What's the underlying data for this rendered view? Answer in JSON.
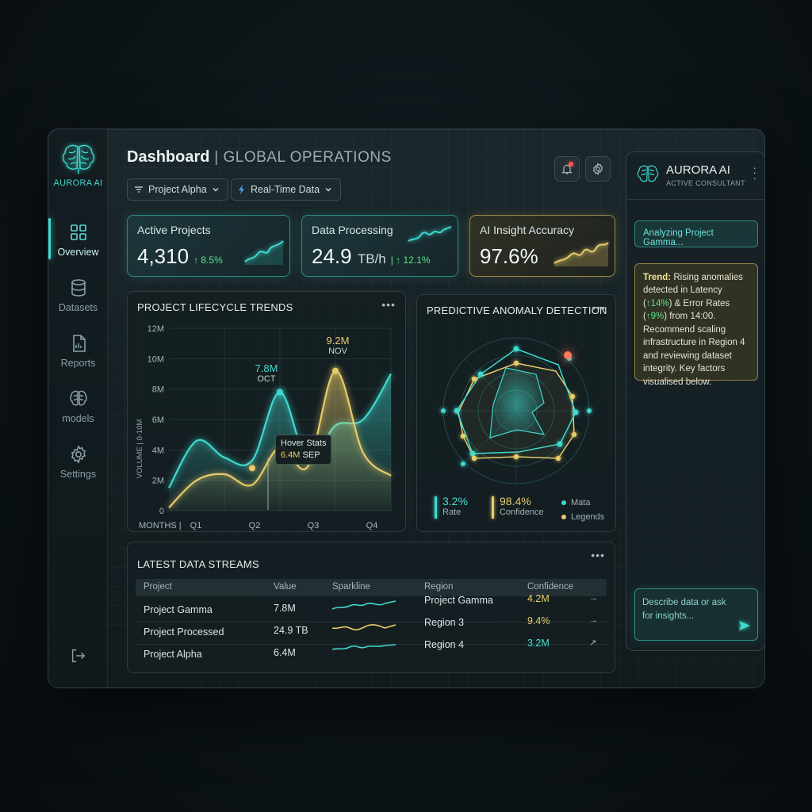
{
  "brand": {
    "name": "AURORA AI"
  },
  "sidebar": {
    "items": [
      {
        "label": "Overview",
        "icon": "grid-icon",
        "active": true
      },
      {
        "label": "Datasets",
        "icon": "database-icon"
      },
      {
        "label": "Reports",
        "icon": "report-icon"
      },
      {
        "label": "models",
        "icon": "brain-icon"
      },
      {
        "label": "Settings",
        "icon": "gear-icon"
      }
    ],
    "logout_icon": "logout-icon"
  },
  "header": {
    "title": "Dashboard",
    "separator": " | ",
    "subtitle": "GLOBAL OPERATIONS",
    "filters": {
      "project": "Project Alpha",
      "mode": "Real-Time Data"
    }
  },
  "kpis": [
    {
      "label": "Active Projects",
      "value": "4,310",
      "unit": "",
      "delta": "↑ 8.5%"
    },
    {
      "label": "Data Processing",
      "value": "24.9",
      "unit": "TB/h",
      "delta": "| ↑ 12.1%"
    },
    {
      "label": "AI Insight Accuracy",
      "value": "97.6%",
      "unit": "",
      "delta": ""
    }
  ],
  "lifecycle": {
    "title": "PROJECT LIFECYCLE TRENDS",
    "ylabel": "VOLUME | 0-10M",
    "xlabel": "MONTHS |",
    "yticks": [
      "12M",
      "10M",
      "8M",
      "6M",
      "4M",
      "2M",
      "0"
    ],
    "xticks": [
      "Q1",
      "Q2",
      "Q3",
      "Q4"
    ],
    "peak1": {
      "value": "7.8M",
      "label": "OCT"
    },
    "peak2": {
      "value": "9.2M",
      "label": "NOV"
    },
    "tooltip": {
      "title": "Hover Stats",
      "value": "6.4M",
      "label": "SEP"
    }
  },
  "chart_data": {
    "type": "area",
    "title": "PROJECT LIFECYCLE TRENDS",
    "ylabel": "VOLUME | 0-10M",
    "xlabel": "MONTHS |",
    "ylim": [
      0,
      12
    ],
    "series": [
      {
        "color": "#3fd9cf",
        "x": [
          0,
          0.5,
          1,
          1.5,
          2,
          2.5,
          3,
          3.5,
          4
        ],
        "values": [
          1.5,
          4.6,
          3.5,
          3.3,
          7.8,
          3.3,
          5.6,
          6.0,
          9.0
        ]
      },
      {
        "color": "#e8cc6a",
        "x": [
          0,
          0.5,
          1,
          1.5,
          2,
          2.5,
          3,
          3.5,
          4
        ],
        "values": [
          0.2,
          2.0,
          2.4,
          1.7,
          4.2,
          2.9,
          9.2,
          3.8,
          2.3
        ]
      }
    ]
  },
  "anomaly": {
    "title": "PREDICTIVE ANOMALY DETECTION",
    "stat1": {
      "value": "3.2%",
      "label": "Rate"
    },
    "stat2": {
      "value": "98.4%",
      "label": "Confidence"
    },
    "legend": [
      "Mata",
      "Legends"
    ]
  },
  "streams": {
    "title": "LATEST DATA STREAMS",
    "columns": [
      "Project",
      "Value",
      "Sparkline",
      "Region",
      "Confidence"
    ],
    "rows": [
      {
        "project": "Project Gamma",
        "value": "7.8M",
        "region": "Project Gamma",
        "confidence": "4.2M",
        "arrow": "→"
      },
      {
        "project": "Project Processed",
        "value": "24.9 TB",
        "region": "Region 3",
        "confidence": "9.4%",
        "arrow": "→"
      },
      {
        "project": "Project Alpha",
        "value": "6.4M",
        "region": "Region 4",
        "confidence": "3.2M",
        "arrow": "↗"
      }
    ]
  },
  "ai": {
    "name": "AURORA AI",
    "role": "ACTIVE CONSULTANT",
    "status": "Analyzing Project Gamma...",
    "insight_label": "Trend:",
    "insight_a": " Rising anomalies detected in Latency (",
    "insight_g1": "↑14%",
    "insight_b": ") & Error Rates (",
    "insight_g2": "↑9%",
    "insight_c": ") from 14:00. Recommend scaling infrastructure in Region 4 and reviewing dataset integrity. Key factors visualised below.",
    "input_placeholder": "Describe data or ask for insights..."
  },
  "colors": {
    "accent": "#3fd9cf",
    "gold": "#e8cc6a",
    "positive": "#5fe08a",
    "alert": "#ff5a52"
  }
}
